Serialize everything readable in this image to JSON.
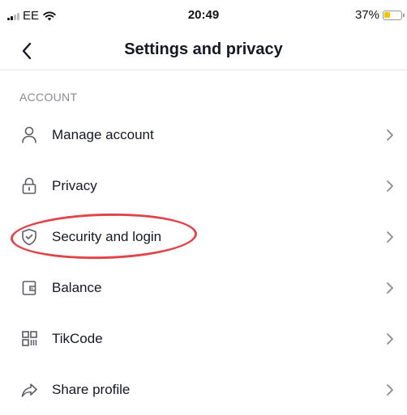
{
  "status_bar": {
    "carrier": "EE",
    "time": "20:49",
    "battery_percent_label": "37%",
    "battery_level": 0.37,
    "icons": [
      "signal-icon",
      "wifi-icon",
      "battery-icon"
    ]
  },
  "header": {
    "title": "Settings and privacy",
    "back_icon": "chevron-left-icon"
  },
  "account_section": {
    "title": "ACCOUNT",
    "items": [
      {
        "label": "Manage account",
        "icon": "person-icon"
      },
      {
        "label": "Privacy",
        "icon": "lock-icon"
      },
      {
        "label": "Security and login",
        "icon": "shield-icon",
        "highlighted": true
      },
      {
        "label": "Balance",
        "icon": "wallet-icon"
      },
      {
        "label": "TikCode",
        "icon": "qr-code-icon"
      },
      {
        "label": "Share profile",
        "icon": "share-icon"
      }
    ]
  },
  "colors": {
    "text": "#161823",
    "section_title": "#8a8b91",
    "icon": "#5c5d63",
    "chevron": "#8a8b91",
    "highlight": "#e0454b",
    "battery": "#f5c400"
  }
}
